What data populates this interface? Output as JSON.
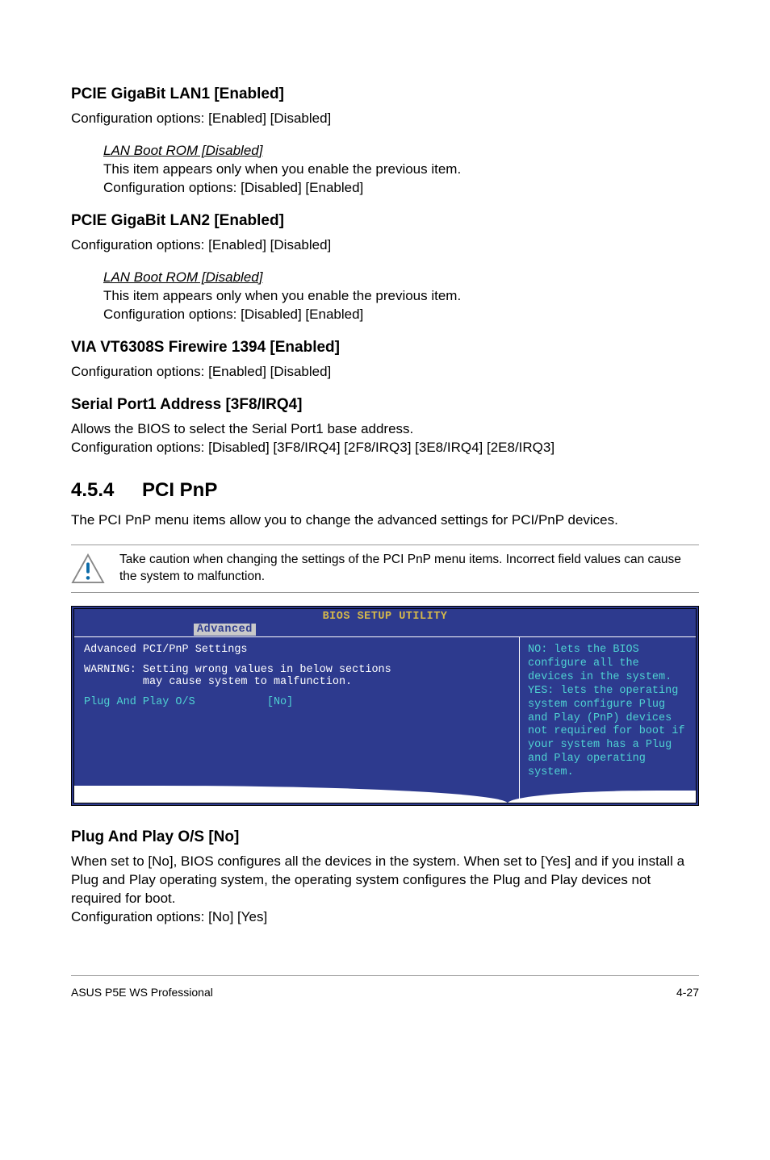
{
  "sections": {
    "pcie_lan1": {
      "heading": "PCIE GigaBit LAN1 [Enabled]",
      "body": "Configuration options: [Enabled] [Disabled]",
      "sub": {
        "title": "LAN Boot ROM [Disabled]",
        "body": "This item appears only when you enable the previous item.\nConfiguration options: [Disabled] [Enabled]"
      }
    },
    "pcie_lan2": {
      "heading": "PCIE GigaBit LAN2 [Enabled]",
      "body": "Configuration options: [Enabled] [Disabled]",
      "sub": {
        "title": "LAN Boot ROM [Disabled]",
        "body": "This item appears only when you enable the previous item.\nConfiguration options: [Disabled] [Enabled]"
      }
    },
    "via_firewire": {
      "heading": "VIA VT6308S Firewire 1394 [Enabled]",
      "body": "Configuration options: [Enabled] [Disabled]"
    },
    "serial_port": {
      "heading": "Serial Port1 Address [3F8/IRQ4]",
      "body": "Allows the BIOS to select the Serial Port1 base address.\nConfiguration options: [Disabled] [3F8/IRQ4] [2F8/IRQ3] [3E8/IRQ4] [2E8/IRQ3]"
    },
    "pci_pnp": {
      "number": "4.5.4",
      "title": "PCI PnP",
      "body": "The PCI PnP menu items allow you to change the advanced settings for PCI/PnP devices.",
      "caution": "Take caution when changing the settings of the PCI PnP menu items. Incorrect field values can cause the system to malfunction."
    },
    "plug_and_play": {
      "heading": "Plug And Play O/S [No]",
      "body": "When set to [No], BIOS configures all the devices in the system. When set to [Yes] and if you install a Plug and Play operating system, the operating system configures the Plug and Play devices not required for boot.\nConfiguration options: [No] [Yes]"
    }
  },
  "bios": {
    "title": "BIOS SETUP UTILITY",
    "tab": "Advanced",
    "left": {
      "heading": "Advanced PCI/PnP Settings",
      "warning_line1": "WARNING: Setting wrong values in below sections",
      "warning_line2": "         may cause system to malfunction.",
      "item_label": "Plug And Play O/S",
      "item_value": "[No]"
    },
    "right": "NO: lets the BIOS configure all the devices in the system. YES: lets the operating system configure Plug and Play (PnP) devices not required for boot if your system has a Plug and Play operating system."
  },
  "footer": {
    "left": "ASUS P5E WS Professional",
    "right": "4-27"
  }
}
